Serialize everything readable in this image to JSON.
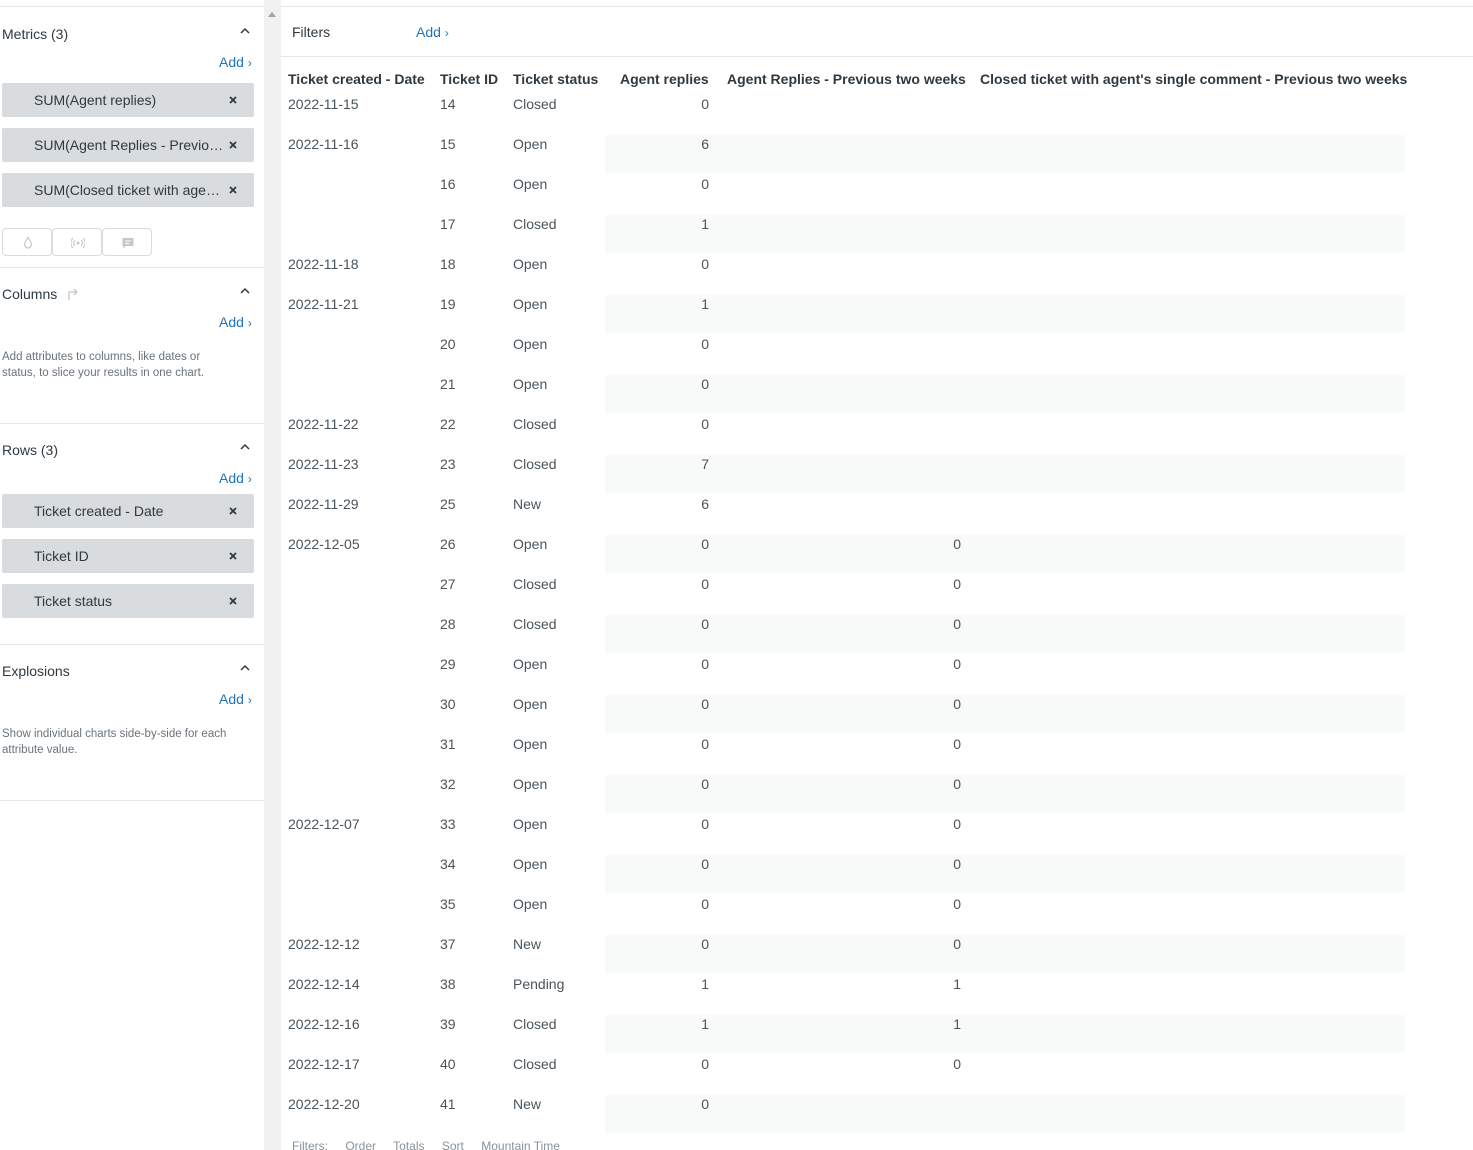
{
  "sidebar": {
    "metrics": {
      "title": "Metrics (3)",
      "add_label": "Add",
      "items": [
        {
          "label": "SUM(Agent replies)"
        },
        {
          "label": "SUM(Agent Replies - Previous two weeks)"
        },
        {
          "label": "SUM(Closed ticket with agent's single comment - Previous two weeks)"
        }
      ],
      "buttons": [
        "drop-icon",
        "broadcast-icon",
        "comment-icon"
      ]
    },
    "columns": {
      "title": "Columns",
      "add_label": "Add",
      "hint": "Add attributes to columns, like dates or status, to slice your results in one chart."
    },
    "rows": {
      "title": "Rows (3)",
      "add_label": "Add",
      "items": [
        {
          "label": "Ticket created - Date"
        },
        {
          "label": "Ticket ID"
        },
        {
          "label": "Ticket status"
        }
      ]
    },
    "explosions": {
      "title": "Explosions",
      "add_label": "Add",
      "hint": "Show individual charts side-by-side for each attribute value."
    }
  },
  "filters": {
    "label": "Filters",
    "add_label": "Add"
  },
  "table": {
    "headers": [
      "Ticket created - Date",
      "Ticket ID",
      "Ticket status",
      "Agent replies",
      "Agent Replies - Previous two weeks",
      "Closed ticket with agent's single comment - Previous two weeks"
    ],
    "rows": [
      {
        "date": "2022-11-15",
        "id": "14",
        "status": "Closed",
        "agent_replies": "0",
        "prev_two_weeks": "",
        "closed_single": ""
      },
      {
        "date": "2022-11-16",
        "id": "15",
        "status": "Open",
        "agent_replies": "6",
        "prev_two_weeks": "",
        "closed_single": ""
      },
      {
        "date": "",
        "id": "16",
        "status": "Open",
        "agent_replies": "0",
        "prev_two_weeks": "",
        "closed_single": ""
      },
      {
        "date": "",
        "id": "17",
        "status": "Closed",
        "agent_replies": "1",
        "prev_two_weeks": "",
        "closed_single": ""
      },
      {
        "date": "2022-11-18",
        "id": "18",
        "status": "Open",
        "agent_replies": "0",
        "prev_two_weeks": "",
        "closed_single": ""
      },
      {
        "date": "2022-11-21",
        "id": "19",
        "status": "Open",
        "agent_replies": "1",
        "prev_two_weeks": "",
        "closed_single": ""
      },
      {
        "date": "",
        "id": "20",
        "status": "Open",
        "agent_replies": "0",
        "prev_two_weeks": "",
        "closed_single": ""
      },
      {
        "date": "",
        "id": "21",
        "status": "Open",
        "agent_replies": "0",
        "prev_two_weeks": "",
        "closed_single": ""
      },
      {
        "date": "2022-11-22",
        "id": "22",
        "status": "Closed",
        "agent_replies": "0",
        "prev_two_weeks": "",
        "closed_single": ""
      },
      {
        "date": "2022-11-23",
        "id": "23",
        "status": "Closed",
        "agent_replies": "7",
        "prev_two_weeks": "",
        "closed_single": ""
      },
      {
        "date": "2022-11-29",
        "id": "25",
        "status": "New",
        "agent_replies": "6",
        "prev_two_weeks": "",
        "closed_single": ""
      },
      {
        "date": "2022-12-05",
        "id": "26",
        "status": "Open",
        "agent_replies": "0",
        "prev_two_weeks": "0",
        "closed_single": ""
      },
      {
        "date": "",
        "id": "27",
        "status": "Closed",
        "agent_replies": "0",
        "prev_two_weeks": "0",
        "closed_single": ""
      },
      {
        "date": "",
        "id": "28",
        "status": "Closed",
        "agent_replies": "0",
        "prev_two_weeks": "0",
        "closed_single": ""
      },
      {
        "date": "",
        "id": "29",
        "status": "Open",
        "agent_replies": "0",
        "prev_two_weeks": "0",
        "closed_single": ""
      },
      {
        "date": "",
        "id": "30",
        "status": "Open",
        "agent_replies": "0",
        "prev_two_weeks": "0",
        "closed_single": ""
      },
      {
        "date": "",
        "id": "31",
        "status": "Open",
        "agent_replies": "0",
        "prev_two_weeks": "0",
        "closed_single": ""
      },
      {
        "date": "",
        "id": "32",
        "status": "Open",
        "agent_replies": "0",
        "prev_two_weeks": "0",
        "closed_single": ""
      },
      {
        "date": "2022-12-07",
        "id": "33",
        "status": "Open",
        "agent_replies": "0",
        "prev_two_weeks": "0",
        "closed_single": ""
      },
      {
        "date": "",
        "id": "34",
        "status": "Open",
        "agent_replies": "0",
        "prev_two_weeks": "0",
        "closed_single": ""
      },
      {
        "date": "",
        "id": "35",
        "status": "Open",
        "agent_replies": "0",
        "prev_two_weeks": "0",
        "closed_single": ""
      },
      {
        "date": "2022-12-12",
        "id": "37",
        "status": "New",
        "agent_replies": "0",
        "prev_two_weeks": "0",
        "closed_single": ""
      },
      {
        "date": "2022-12-14",
        "id": "38",
        "status": "Pending",
        "agent_replies": "1",
        "prev_two_weeks": "1",
        "closed_single": ""
      },
      {
        "date": "2022-12-16",
        "id": "39",
        "status": "Closed",
        "agent_replies": "1",
        "prev_two_weeks": "1",
        "closed_single": ""
      },
      {
        "date": "2022-12-17",
        "id": "40",
        "status": "Closed",
        "agent_replies": "0",
        "prev_two_weeks": "0",
        "closed_single": ""
      },
      {
        "date": "2022-12-20",
        "id": "41",
        "status": "New",
        "agent_replies": "0",
        "prev_two_weeks": "",
        "closed_single": ""
      }
    ]
  },
  "footer": [
    "Filters:",
    "Order",
    "Totals",
    "Sort",
    "Mountain Time"
  ]
}
